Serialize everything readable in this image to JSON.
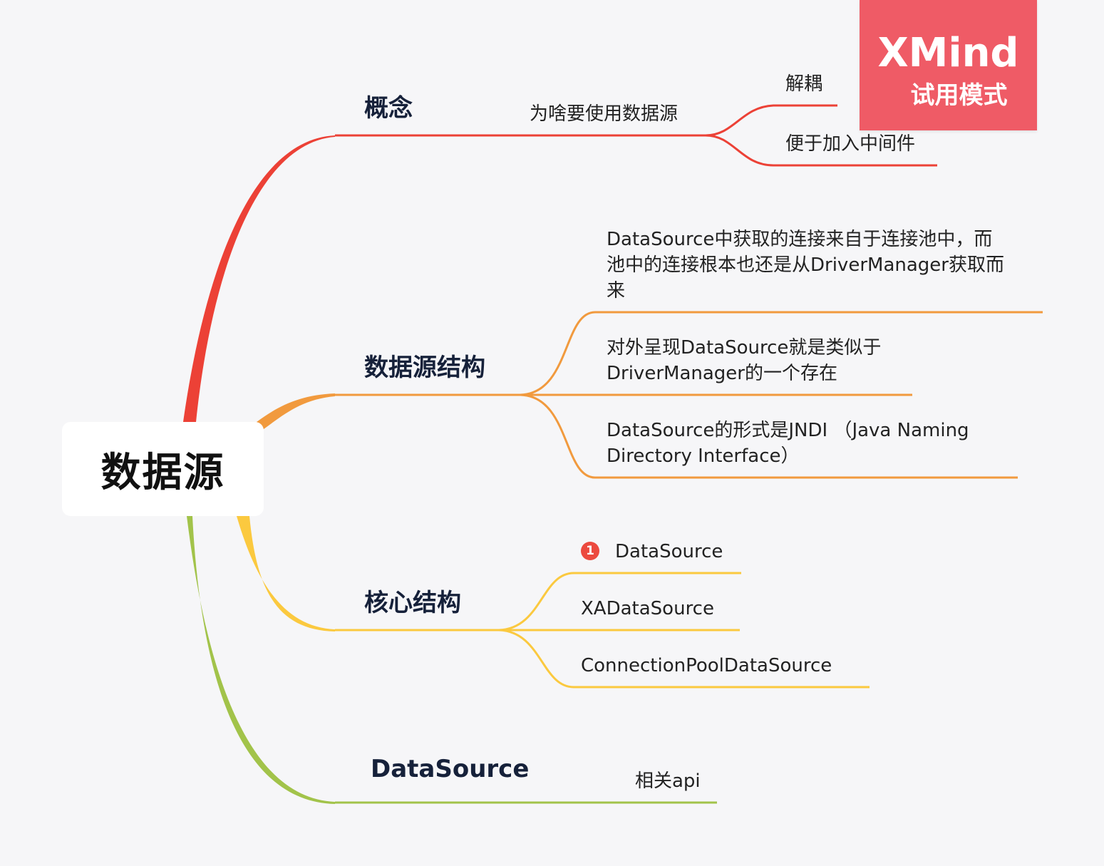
{
  "root": {
    "label": "数据源"
  },
  "branches": [
    {
      "id": "concept",
      "title": "概念",
      "color": "#ec4136",
      "children": [
        {
          "label": "为啥要使用数据源",
          "children": [
            {
              "label": "解耦"
            },
            {
              "label": "便于加入中间件"
            }
          ]
        }
      ]
    },
    {
      "id": "structure",
      "title": "数据源结构",
      "color": "#f19a3e",
      "children": [
        {
          "lines": [
            "DataSource中获取的连接来自于连接池中，而",
            "池中的连接根本也还是从DriverManager获取而",
            "来"
          ]
        },
        {
          "lines": [
            "对外呈现DataSource就是类似于",
            "DriverManager的一个存在"
          ]
        },
        {
          "lines": [
            "DataSource的形式是JNDI （Java Naming",
            "Directory Interface）"
          ]
        }
      ]
    },
    {
      "id": "core",
      "title": "核心结构",
      "color": "#fbc93f",
      "children": [
        {
          "label": "DataSource",
          "marker": "1"
        },
        {
          "label": "XADataSource"
        },
        {
          "label": "ConnectionPoolDataSource"
        }
      ]
    },
    {
      "id": "datasource",
      "title": "DataSource",
      "color": "#a2c34a",
      "children": [
        {
          "label": "相关api"
        }
      ]
    }
  ],
  "watermark": {
    "brand": "XMind",
    "mode": "试用模式"
  }
}
